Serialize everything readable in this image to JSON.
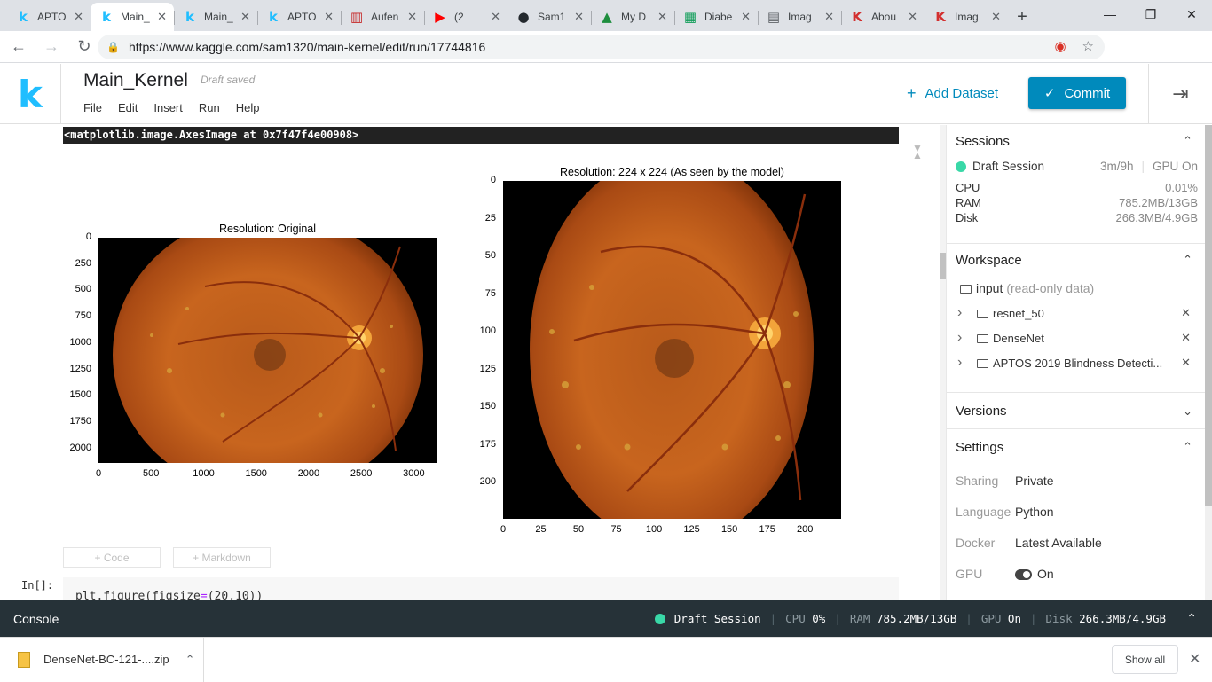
{
  "browser": {
    "tabs": [
      {
        "title": "APTO",
        "icon": "kaggle-icon",
        "icon_glyph": "k",
        "icon_color": "#20beff",
        "active": false
      },
      {
        "title": "Main_",
        "icon": "kaggle-icon",
        "icon_glyph": "k",
        "icon_color": "#20beff",
        "active": true
      },
      {
        "title": "Main_",
        "icon": "kaggle-icon",
        "icon_glyph": "k",
        "icon_color": "#20beff",
        "active": false
      },
      {
        "title": "APTO",
        "icon": "kaggle-icon",
        "icon_glyph": "k",
        "icon_color": "#20beff",
        "active": false
      },
      {
        "title": "Aufen",
        "icon": "bar-icon",
        "icon_glyph": "▥",
        "icon_color": "#c62828",
        "active": false
      },
      {
        "title": "(2",
        "icon": "youtube-icon",
        "icon_glyph": "▶",
        "icon_color": "#ff0000",
        "active": false
      },
      {
        "title": "Sam1",
        "icon": "github-icon",
        "icon_glyph": "●",
        "icon_color": "#24292e",
        "active": false
      },
      {
        "title": "My D",
        "icon": "drive-icon",
        "icon_glyph": "▲",
        "icon_color": "#1e8e3e",
        "active": false
      },
      {
        "title": "Diabe",
        "icon": "sheets-icon",
        "icon_glyph": "▦",
        "icon_color": "#0f9d58",
        "active": false
      },
      {
        "title": "Imag",
        "icon": "page-icon",
        "icon_glyph": "▤",
        "icon_color": "#5f6368",
        "active": false
      },
      {
        "title": "Abou",
        "icon": "k-red-icon",
        "icon_glyph": "K",
        "icon_color": "#d32f2f",
        "active": false
      },
      {
        "title": "Imag",
        "icon": "k-red-icon",
        "icon_glyph": "K",
        "icon_color": "#d32f2f",
        "active": false
      }
    ],
    "url": "https://www.kaggle.com/sam1320/main-kernel/edit/run/17744816"
  },
  "kaggle": {
    "logo": "k",
    "notebook_title": "Main_Kernel",
    "draft_status": "Draft saved",
    "menu": [
      "File",
      "Edit",
      "Insert",
      "Run",
      "Help"
    ],
    "add_dataset": "Add Dataset",
    "commit": "Commit",
    "accent": "#008abc"
  },
  "notebook": {
    "output_text": "<matplotlib.image.AxesImage at 0x7f47f4e00908>",
    "add_code": "+ Code",
    "add_markdown": "+ Markdown",
    "in_prompt": "In[]:",
    "code_line": {
      "fn": "plt.figure(figsize",
      "op": "=",
      "args": "(20,10))"
    }
  },
  "chart_data": [
    {
      "type": "image",
      "title": "Resolution: Original",
      "xticks": [
        "0",
        "500",
        "1000",
        "1500",
        "2000",
        "2500",
        "3000"
      ],
      "yticks": [
        "0",
        "250",
        "500",
        "750",
        "1000",
        "1250",
        "1500",
        "1750",
        "2000"
      ],
      "xlim": [
        0,
        3216
      ],
      "ylim": [
        2136,
        0
      ]
    },
    {
      "type": "image",
      "title": "Resolution: 224 x 224 (As seen by the model)",
      "xticks": [
        "0",
        "25",
        "50",
        "75",
        "100",
        "125",
        "150",
        "175",
        "200"
      ],
      "yticks": [
        "0",
        "25",
        "50",
        "75",
        "100",
        "125",
        "150",
        "175",
        "200"
      ],
      "xlim": [
        0,
        224
      ],
      "ylim": [
        224,
        0
      ]
    }
  ],
  "sidebar": {
    "sessions": {
      "title": "Sessions",
      "session_name": "Draft Session",
      "session_time": "3m/9h",
      "gpu_status": "GPU On",
      "stats": [
        {
          "label": "CPU",
          "value": "0.01%"
        },
        {
          "label": "RAM",
          "value": "785.2MB/13GB"
        },
        {
          "label": "Disk",
          "value": "266.3MB/4.9GB"
        }
      ]
    },
    "workspace": {
      "title": "Workspace",
      "input_label": "input",
      "input_note": "(read-only data)",
      "items": [
        "resnet_50",
        "DenseNet",
        "APTOS 2019 Blindness Detecti..."
      ]
    },
    "versions": {
      "title": "Versions"
    },
    "settings": {
      "title": "Settings",
      "rows": [
        {
          "key": "Sharing",
          "value": "Private"
        },
        {
          "key": "Language",
          "value": "Python"
        },
        {
          "key": "Docker",
          "value": "Latest Available"
        },
        {
          "key": "GPU",
          "value": "On"
        }
      ]
    }
  },
  "console": {
    "label": "Console",
    "session": "Draft Session",
    "cpu_label": "CPU",
    "cpu_value": "0%",
    "ram_label": "RAM",
    "ram_value": "785.2MB/13GB",
    "gpu_label": "GPU",
    "gpu_value": "On",
    "disk_label": "Disk",
    "disk_value": "266.3MB/4.9GB"
  },
  "downloads": {
    "file": "DenseNet-BC-121-....zip",
    "show_all": "Show all"
  }
}
